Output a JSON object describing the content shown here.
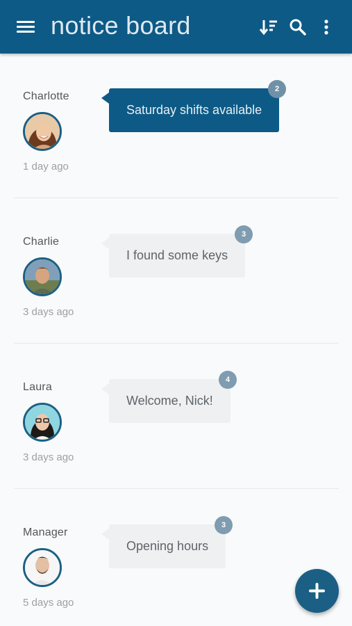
{
  "app_bar": {
    "title": "notice board",
    "icons": [
      "menu-icon",
      "sort-icon",
      "search-icon",
      "more-vert-icon"
    ]
  },
  "notices": [
    {
      "author": "Charlotte",
      "time": "1 day ago",
      "message": "Saturday shifts available",
      "count": "2",
      "highlighted": true
    },
    {
      "author": "Charlie",
      "time": "3 days ago",
      "message": "I found some keys",
      "count": "3",
      "highlighted": false
    },
    {
      "author": "Laura",
      "time": "3 days ago",
      "message": "Welcome, Nick!",
      "count": "4",
      "highlighted": false
    },
    {
      "author": "Manager",
      "time": "5 days ago",
      "message": "Opening hours",
      "count": "3",
      "highlighted": false
    }
  ],
  "fab": {
    "icon": "plus-icon"
  },
  "colors": {
    "primary": "#0d5a86",
    "bubble_bg": "#eef0f2",
    "badge": "#7f9cb0",
    "background": "#f9fafb"
  }
}
